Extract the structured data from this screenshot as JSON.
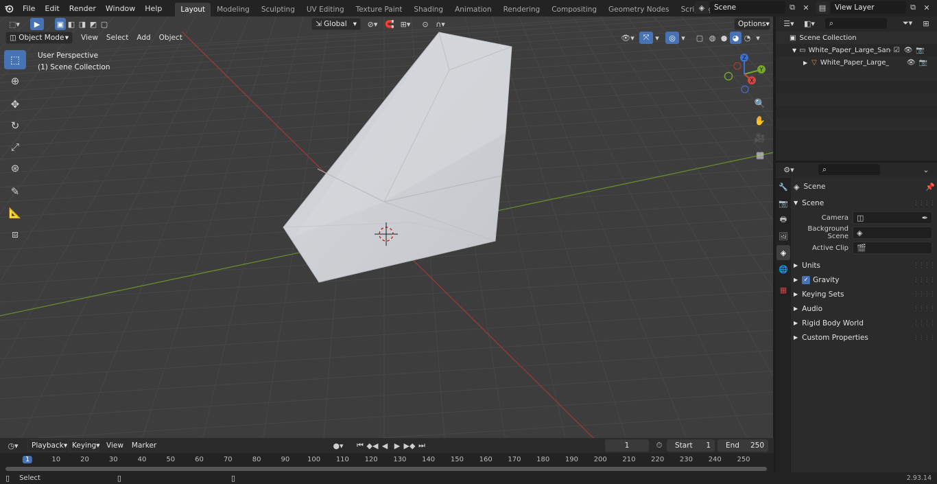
{
  "app": {
    "version": "2.93.14"
  },
  "menu": [
    "File",
    "Edit",
    "Render",
    "Window",
    "Help"
  ],
  "workspaces": [
    {
      "label": "Layout",
      "active": true
    },
    {
      "label": "Modeling"
    },
    {
      "label": "Sculpting"
    },
    {
      "label": "UV Editing"
    },
    {
      "label": "Texture Paint"
    },
    {
      "label": "Shading"
    },
    {
      "label": "Animation"
    },
    {
      "label": "Rendering"
    },
    {
      "label": "Compositing"
    },
    {
      "label": "Geometry Nodes"
    },
    {
      "label": "Scripting"
    }
  ],
  "scene_field": "Scene",
  "view_layer_field": "View Layer",
  "viewport": {
    "mode": "Object Mode",
    "menus": [
      "View",
      "Select",
      "Add",
      "Object"
    ],
    "orientation": "Global",
    "options_label": "Options",
    "info_line1": "User Perspective",
    "info_line2": "(1) Scene Collection",
    "gizmo": {
      "z": "Z",
      "y": "Y",
      "x": "X"
    },
    "colors": {
      "bg": "#3d3d3d",
      "grid": "#4a4a4a",
      "x_axis": "#9b3a3a",
      "y_axis": "#6a8b2c",
      "mesh": "#c9ccd0"
    }
  },
  "outliner": {
    "root": "Scene Collection",
    "items": [
      {
        "label": "White_Paper_Large_Sandwich",
        "icon": "collection-icon"
      },
      {
        "label": "White_Paper_Large_Sanc",
        "icon": "mesh-object-icon"
      }
    ]
  },
  "properties": {
    "header": "Scene",
    "panel_title": "Scene",
    "fields": [
      {
        "label": "Camera",
        "icon": "camera-icon",
        "value": ""
      },
      {
        "label": "Background Scene",
        "icon": "scene-icon",
        "value": ""
      },
      {
        "label": "Active Clip",
        "icon": "clip-icon",
        "value": ""
      }
    ],
    "panels": [
      "Units",
      "Gravity",
      "Keying Sets",
      "Audio",
      "Rigid Body World",
      "Custom Properties"
    ],
    "gravity_checked": true
  },
  "timeline": {
    "menus": [
      "Playback",
      "Keying",
      "View",
      "Marker"
    ],
    "current_frame": "1",
    "start_label": "Start",
    "start": "1",
    "end_label": "End",
    "end": "250",
    "ticks": [
      "1",
      "10",
      "20",
      "30",
      "40",
      "50",
      "60",
      "70",
      "80",
      "90",
      "100",
      "110",
      "120",
      "130",
      "140",
      "150",
      "160",
      "170",
      "180",
      "190",
      "200",
      "210",
      "220",
      "230",
      "240",
      "250"
    ]
  },
  "status": {
    "left": "Select"
  }
}
